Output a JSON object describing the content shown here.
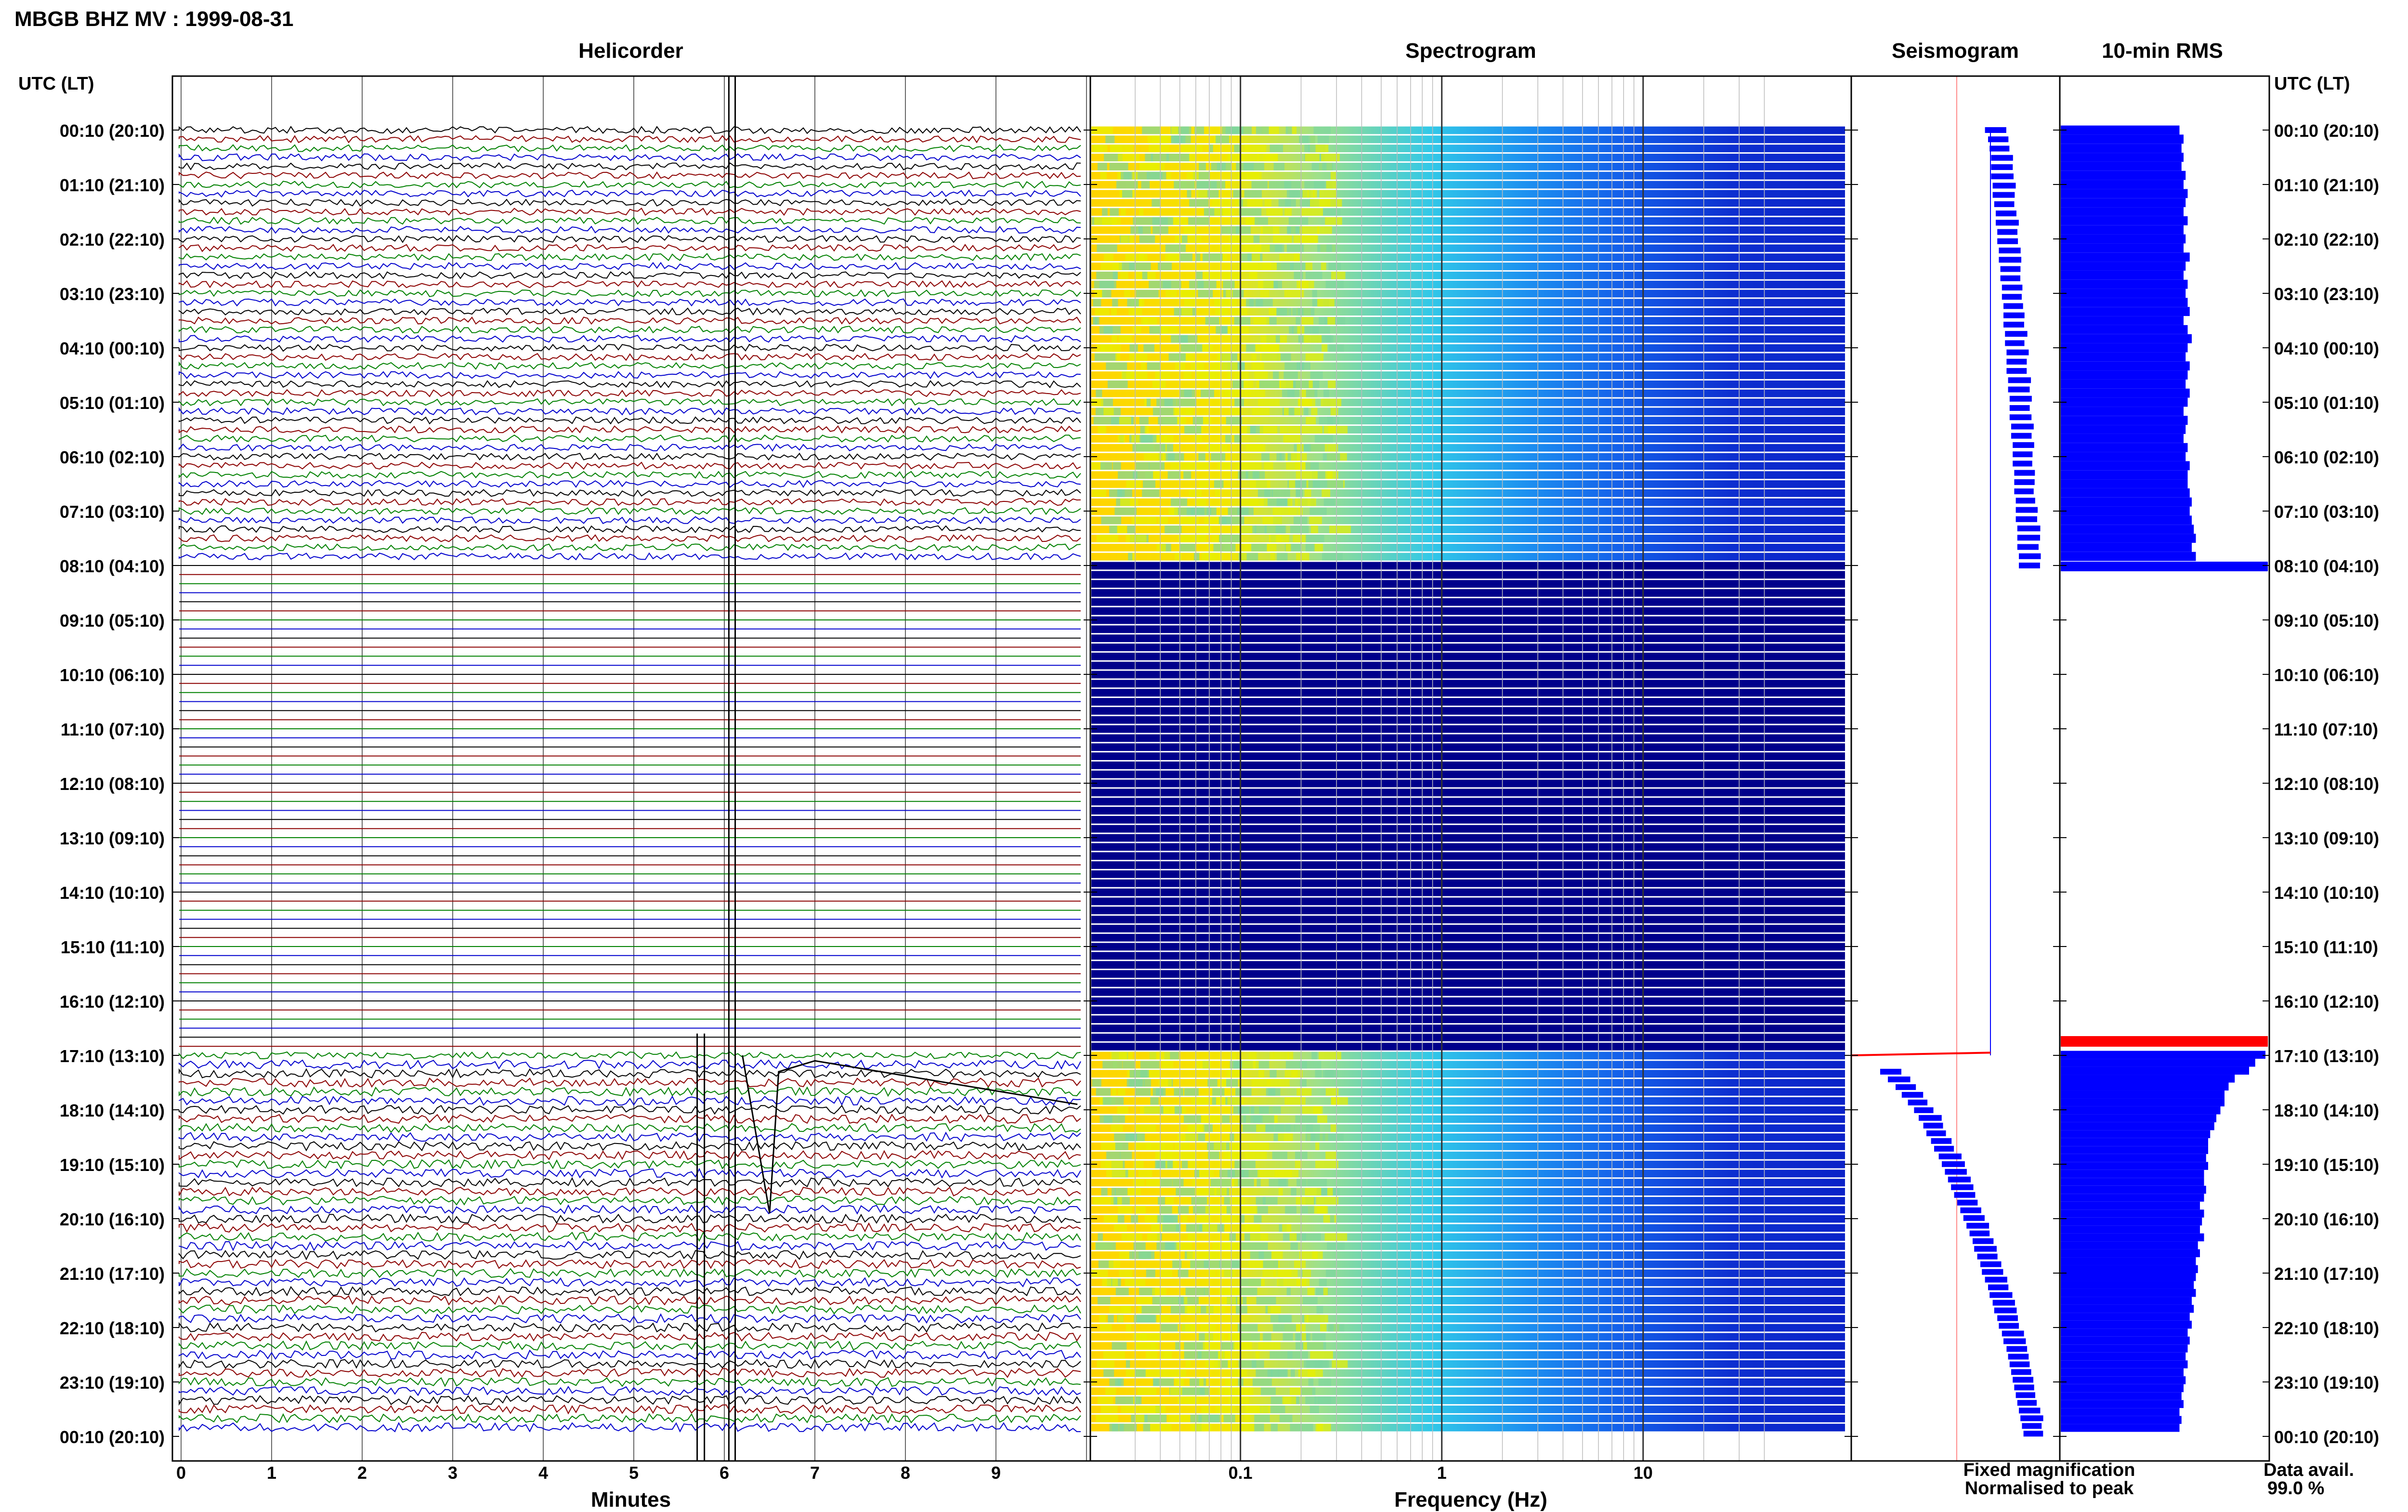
{
  "header": {
    "title": "MBGB BHZ MV : 1999-08-31"
  },
  "panels": {
    "helicorder": "Helicorder",
    "spectrogram": "Spectrogram",
    "seismogram": "Seismogram",
    "rms": "10-min RMS"
  },
  "axes": {
    "time_label_left": "UTC (LT)",
    "time_label_right": "UTC (LT)",
    "minutes_label": "Minutes",
    "frequency_label": "Frequency (Hz)"
  },
  "legend": {
    "fixed": "Fixed magnification",
    "normalised": "Normalised to peak",
    "fixed_color": "#0000ff",
    "normalised_color": "#ff0000"
  },
  "availability": {
    "label": "Data avail.",
    "value": "99.0 %"
  },
  "chart_data": {
    "type": "helicorder-spectrogram",
    "time_ticks": [
      "00:10 (20:10)",
      "01:10 (21:10)",
      "02:10 (22:10)",
      "03:10 (23:10)",
      "04:10 (00:10)",
      "05:10 (01:10)",
      "06:10 (02:10)",
      "07:10 (03:10)",
      "08:10 (04:10)",
      "09:10 (05:10)",
      "10:10 (06:10)",
      "11:10 (07:10)",
      "12:10 (08:10)",
      "13:10 (09:10)",
      "14:10 (10:10)",
      "15:10 (11:10)",
      "16:10 (12:10)",
      "17:10 (13:10)",
      "18:10 (14:10)",
      "19:10 (15:10)",
      "20:10 (16:10)",
      "21:10 (17:10)",
      "22:10 (18:10)",
      "23:10 (19:10)",
      "00:10 (20:10)"
    ],
    "minute_ticks": [
      "0",
      "1",
      "2",
      "3",
      "4",
      "5",
      "6",
      "7",
      "8",
      "9"
    ],
    "frequency_ticks": [
      "0.1",
      "1",
      "10"
    ],
    "frequency_range_hz": [
      0.025,
      50
    ],
    "trace_colors": [
      "#000000",
      "#8b0000",
      "#008000",
      "#0000cd"
    ],
    "rows_per_hour": 6,
    "data_gap_hours": [
      8.0,
      17.0
    ],
    "spectrogram_gap_color": "#00008b",
    "rms_values_relative": [
      0.58,
      0.6,
      0.59,
      0.6,
      0.59,
      0.61,
      0.6,
      0.62,
      0.61,
      0.6,
      0.62,
      0.6,
      0.61,
      0.6,
      0.63,
      0.61,
      0.6,
      0.62,
      0.61,
      0.62,
      0.63,
      0.6,
      0.62,
      0.64,
      0.62,
      0.61,
      0.63,
      0.62,
      0.61,
      0.63,
      0.62,
      0.6,
      0.62,
      0.61,
      0.6,
      0.62,
      0.61,
      0.63,
      0.62,
      0.62,
      0.63,
      0.64,
      0.63,
      0.64,
      0.65,
      0.66,
      0.64,
      0.66,
      1.0,
      0.95,
      0.92,
      0.85,
      0.82,
      0.8,
      0.8,
      0.78,
      0.76,
      0.75,
      0.73,
      0.72,
      0.72,
      0.71,
      0.72,
      0.7,
      0.7,
      0.71,
      0.7,
      0.68,
      0.7,
      0.69,
      0.68,
      0.7,
      0.67,
      0.68,
      0.66,
      0.67,
      0.66,
      0.65,
      0.66,
      0.64,
      0.65,
      0.63,
      0.64,
      0.62,
      0.63,
      0.62,
      0.61,
      0.62,
      0.6,
      0.61,
      0.6,
      0.59,
      0.6,
      0.58,
      0.59,
      0.58
    ],
    "seismogram_envelope_relative": [
      0.68,
      0.7,
      0.71,
      0.72,
      0.72,
      0.72,
      0.73,
      0.73,
      0.74,
      0.75,
      0.75,
      0.76,
      0.76,
      0.77,
      0.77,
      0.78,
      0.78,
      0.79,
      0.79,
      0.8,
      0.8,
      0.8,
      0.81,
      0.81,
      0.82,
      0.82,
      0.82,
      0.83,
      0.83,
      0.84,
      0.84,
      0.84,
      0.85,
      0.85,
      0.86,
      0.86,
      0.86,
      0.87,
      0.87,
      0.87,
      0.88,
      0.88,
      0.88,
      0.89,
      0.89,
      0.89,
      0.9,
      0.9,
      0.0,
      0.05,
      0.1,
      0.14,
      0.18,
      0.22,
      0.25,
      0.28,
      0.3,
      0.33,
      0.35,
      0.38,
      0.4,
      0.42,
      0.44,
      0.46,
      0.48,
      0.5,
      0.52,
      0.54,
      0.56,
      0.58,
      0.6,
      0.61,
      0.63,
      0.65,
      0.66,
      0.68,
      0.7,
      0.71,
      0.73,
      0.74,
      0.76,
      0.77,
      0.79,
      0.8,
      0.82,
      0.83,
      0.84,
      0.85,
      0.86,
      0.87,
      0.88,
      0.89,
      0.9,
      0.91,
      0.92,
      0.93
    ]
  }
}
